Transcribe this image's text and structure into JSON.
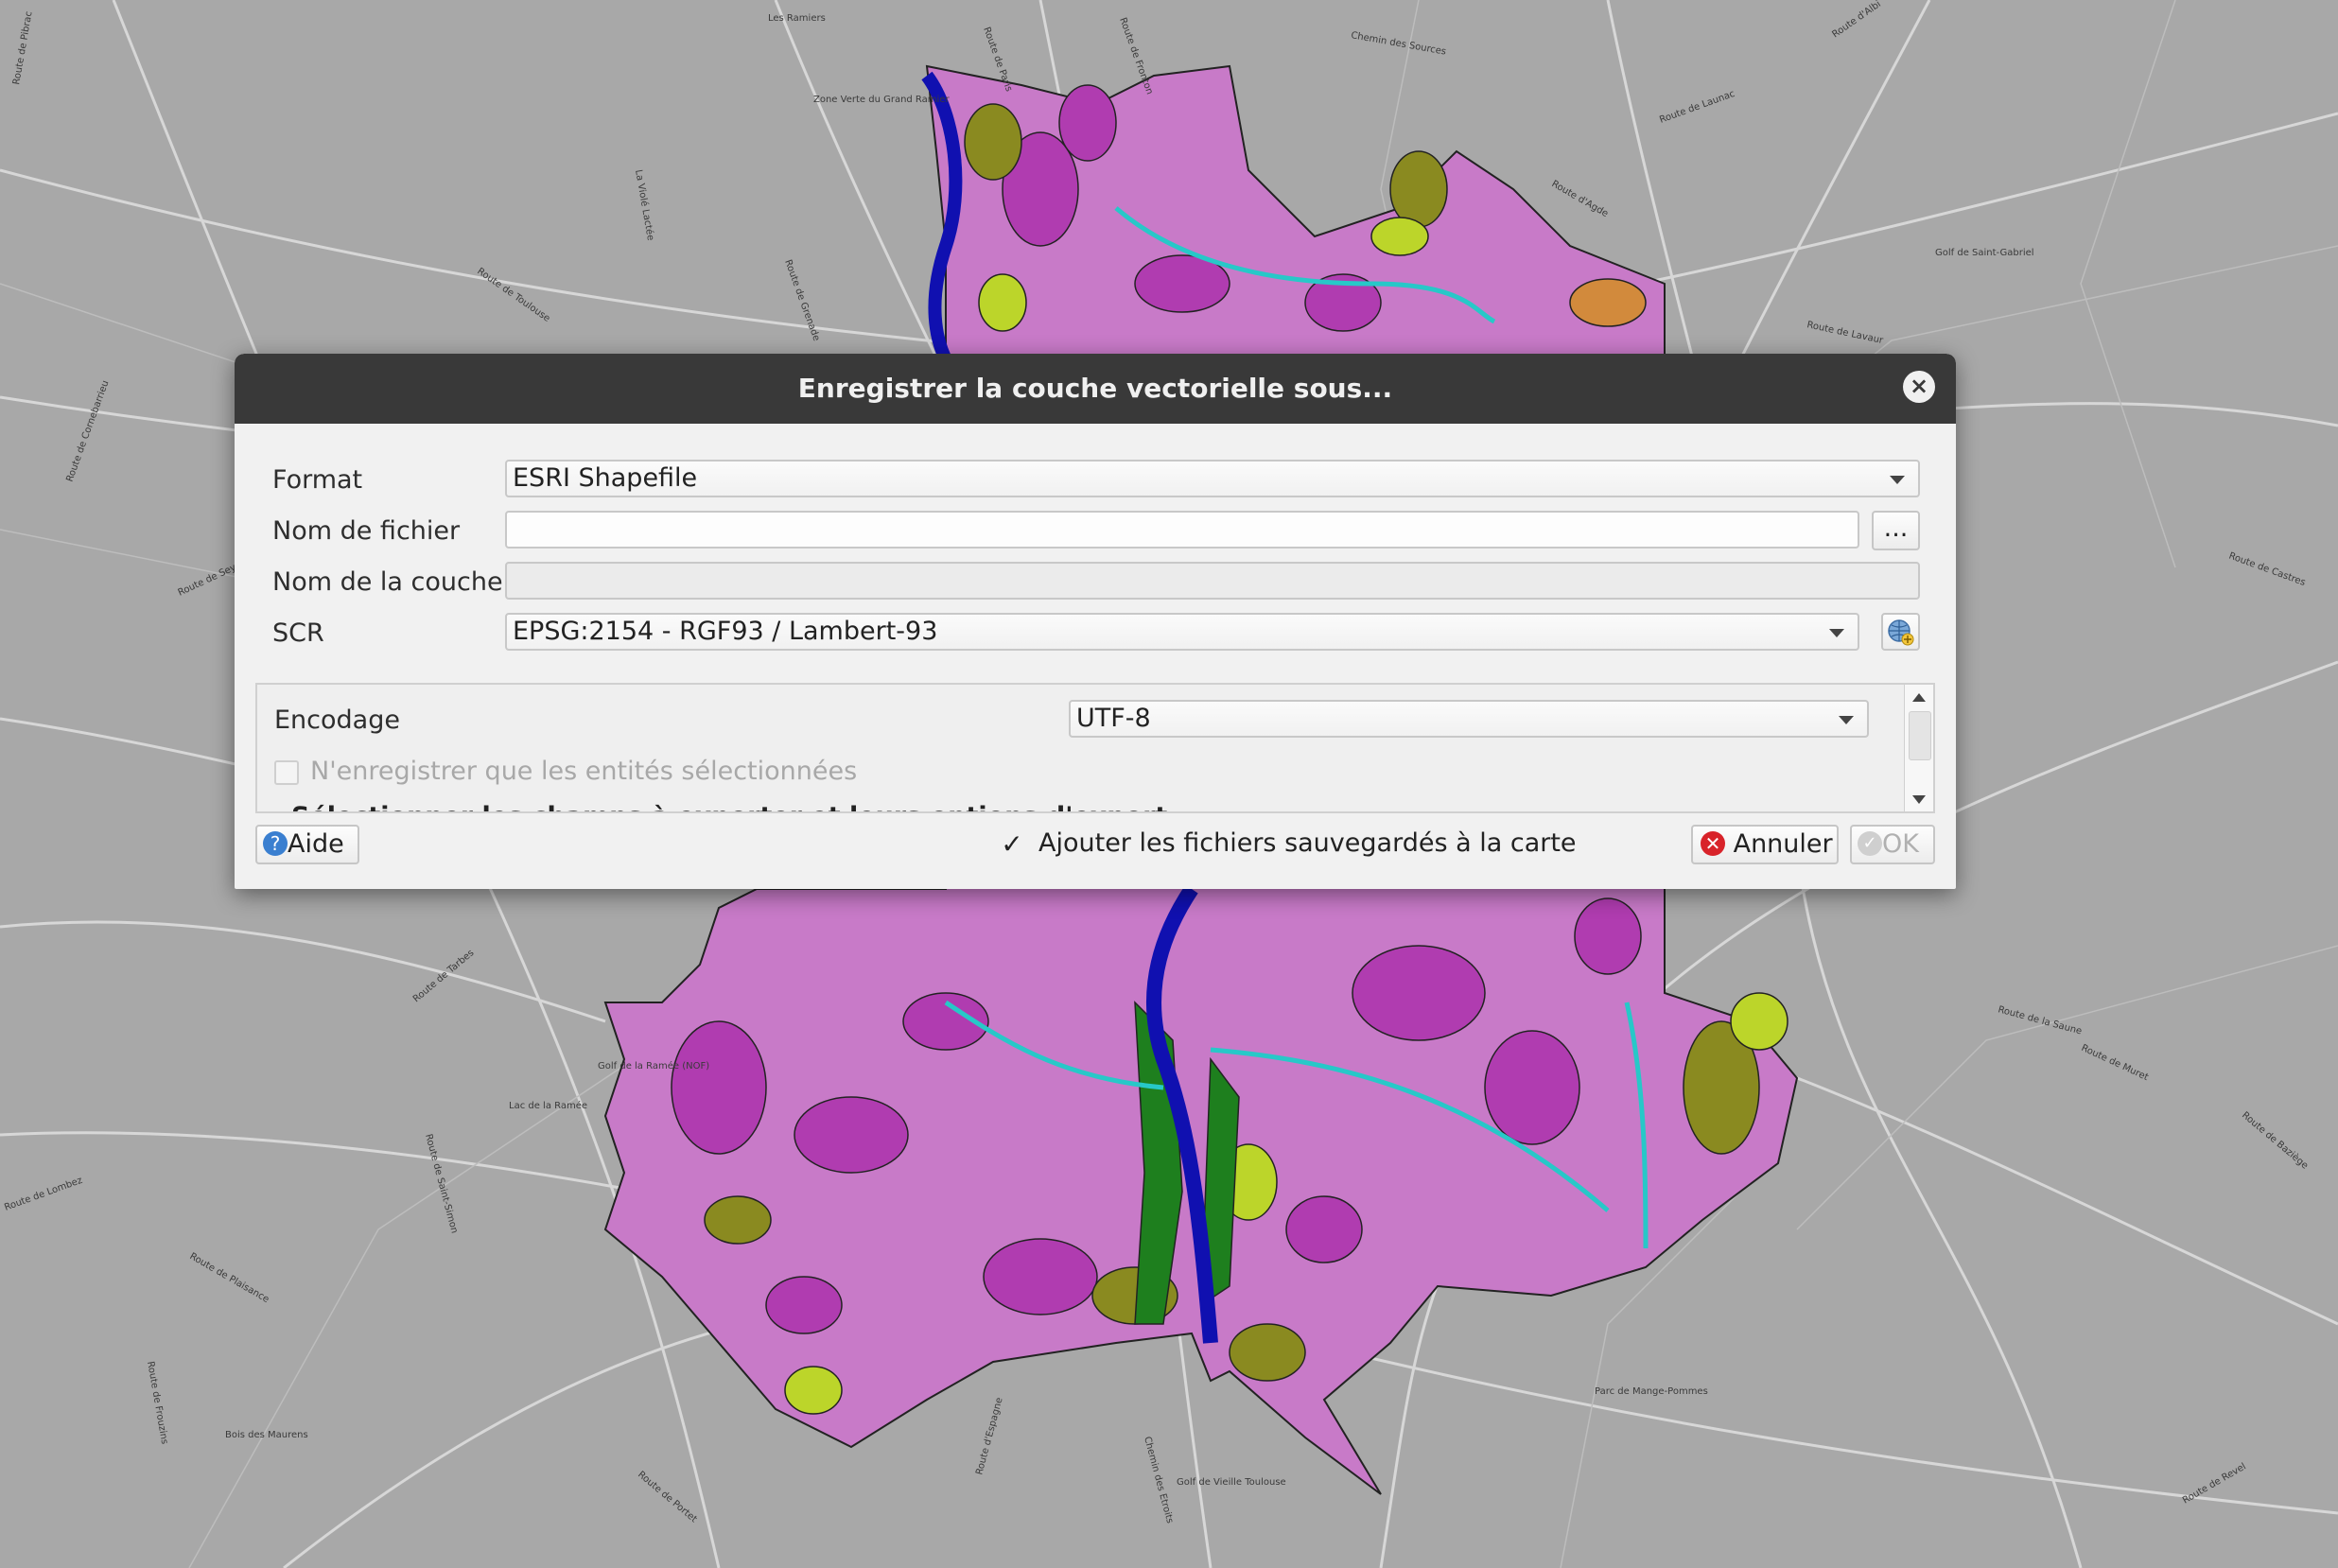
{
  "dialog": {
    "title": "Enregistrer la couche vectorielle sous...",
    "close_icon": "×",
    "format": {
      "label": "Format",
      "value": "ESRI Shapefile"
    },
    "filename": {
      "label": "Nom de fichier",
      "value": "",
      "browse_label": "..."
    },
    "layername": {
      "label": "Nom de la couche",
      "value": ""
    },
    "crs": {
      "label": "SCR",
      "value": "EPSG:2154 - RGF93 / Lambert-93",
      "selector_icon": "crs-globe-icon"
    },
    "options": {
      "encoding": {
        "label": "Encodage",
        "value": "UTF-8"
      },
      "selected_only": {
        "label": "N'enregistrer que les entités sélectionnées",
        "checked": false,
        "enabled": false
      },
      "fields_heading_partial": "Sélectionner les champs à exporter et leurs options d'export"
    },
    "footer": {
      "help_label": "Aide",
      "add_to_map": {
        "label": "Ajouter les fichiers sauvegardés à la carte",
        "checked": true
      },
      "cancel_label": "Annuler",
      "ok_label": "OK"
    }
  },
  "map": {
    "labels": [
      "Les Ramiers",
      "Route de Paris",
      "Route de Fronton",
      "Chemin des Sources",
      "Route d'Albi",
      "Route de Pibrac",
      "Zone Verte du Grand Ramier",
      "La Violé Lactée",
      "Route d'Agde",
      "Golf de Saint-Gabriel",
      "Route de Toulouse",
      "Route de Grenade",
      "Route de Launac",
      "Route de Lavaur",
      "Route de Cornebarrieu",
      "Route de Tarbes",
      "Golf de la Ramée (NOF)",
      "Lac de la Ramée",
      "Route de Lombez",
      "Route de Saint-Simon",
      "Route de Plaisance",
      "Route de Frouzins",
      "Bois des Maurens",
      "Route de Portet",
      "Route d'Espagne",
      "Chemin des Etroits",
      "Golf de Vieille Toulouse",
      "Parc de Mange-Pommes",
      "Route de Revel",
      "Route de la Saune",
      "Route de Castres",
      "Route de Baziège",
      "Route de Seysses",
      "Route de Muret"
    ]
  }
}
